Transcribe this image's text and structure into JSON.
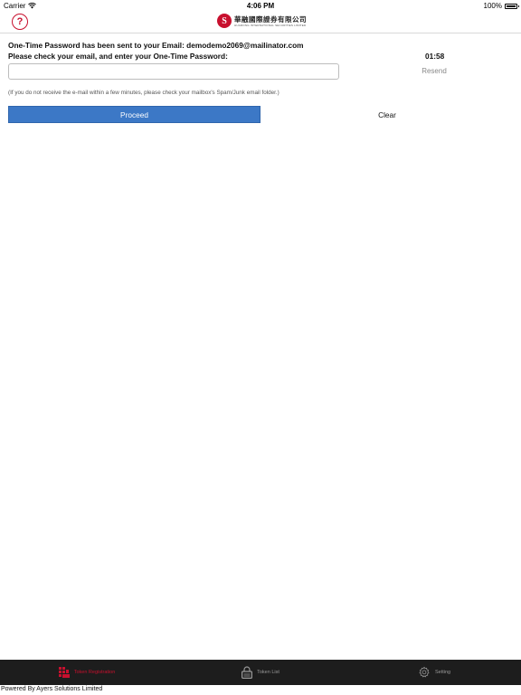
{
  "status_bar": {
    "carrier": "Carrier",
    "time": "4:06 PM",
    "battery": "100%"
  },
  "header": {
    "help_label": "?",
    "logo_mark": "S",
    "logo_cn": "華融國際證券有限公司",
    "logo_en": "HUARONG INTERNATIONAL SECURITIES LIMITED"
  },
  "otp": {
    "line1": "One-Time Password has been sent to your Email: demodemo2069@mailinator.com",
    "line2": "Please check your email, and enter your One-Time Password:",
    "countdown": "01:58",
    "input_value": "",
    "input_placeholder": "",
    "resend_label": "Resend",
    "hint": "(If you do not receive the e-mail within a few minutes, please check your mailbox's Spam/Junk email folder.)",
    "proceed_label": "Proceed",
    "clear_label": "Clear"
  },
  "tabs": [
    {
      "label": "Token Registration",
      "icon": "token-registration-icon",
      "active": true
    },
    {
      "label": "Token List",
      "icon": "token-list-icon",
      "active": false
    },
    {
      "label": "Setting",
      "icon": "gear-icon",
      "active": false
    }
  ],
  "footer": {
    "text": "Powered By Ayers Solutions Limited"
  },
  "colors": {
    "brand_red": "#c8102e",
    "button_blue": "#3c78c6",
    "tab_bar_bg": "#1d1d1d"
  }
}
